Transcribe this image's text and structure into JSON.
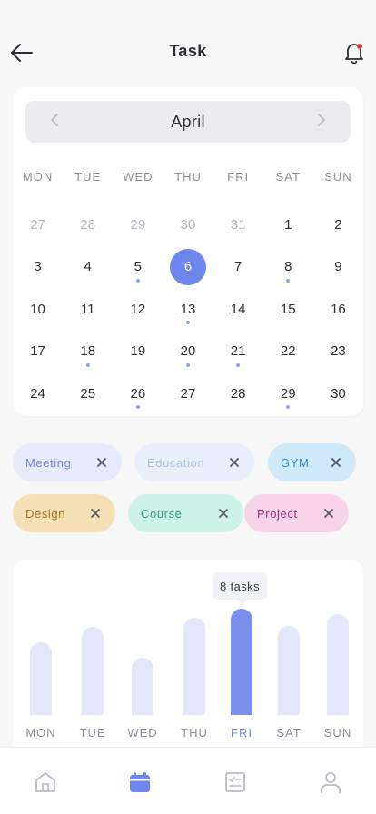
{
  "header": {
    "title": "Task"
  },
  "calendar": {
    "month": "April",
    "weekdays": [
      "MON",
      "TUE",
      "WED",
      "THU",
      "FRI",
      "SAT",
      "SUN"
    ],
    "days": [
      {
        "n": "27",
        "muted": true
      },
      {
        "n": "28",
        "muted": true
      },
      {
        "n": "29",
        "muted": true
      },
      {
        "n": "30",
        "muted": true
      },
      {
        "n": "31",
        "muted": true
      },
      {
        "n": "1"
      },
      {
        "n": "2"
      },
      {
        "n": "3"
      },
      {
        "n": "4"
      },
      {
        "n": "5",
        "dot": true
      },
      {
        "n": "6",
        "selected": true
      },
      {
        "n": "7"
      },
      {
        "n": "8",
        "dot": true
      },
      {
        "n": "9"
      },
      {
        "n": "10"
      },
      {
        "n": "11"
      },
      {
        "n": "12"
      },
      {
        "n": "13",
        "dot": true
      },
      {
        "n": "14"
      },
      {
        "n": "15"
      },
      {
        "n": "16"
      },
      {
        "n": "17"
      },
      {
        "n": "18",
        "dot": true
      },
      {
        "n": "19"
      },
      {
        "n": "20",
        "dot": true
      },
      {
        "n": "21",
        "dot": true
      },
      {
        "n": "22"
      },
      {
        "n": "23"
      },
      {
        "n": "24"
      },
      {
        "n": "25"
      },
      {
        "n": "26",
        "dot": true
      },
      {
        "n": "27"
      },
      {
        "n": "28"
      },
      {
        "n": "29",
        "dot": true
      },
      {
        "n": "30"
      }
    ]
  },
  "chips": [
    {
      "label": "Meeting",
      "bg": "#e6eafb",
      "fg": "#6f86ec",
      "x": "#555a66"
    },
    {
      "label": "Education",
      "bg": "#e9f0fc",
      "fg": "#a9c3e6",
      "x": "#555a66"
    },
    {
      "label": "GYM",
      "bg": "#cfe9fb",
      "fg": "#2f89c7",
      "x": "#555a66"
    },
    {
      "label": "Design",
      "bg": "#f5dfb4",
      "fg": "#a3731c",
      "x": "#555a66"
    },
    {
      "label": "Course",
      "bg": "#cdf3e9",
      "fg": "#2a9a80",
      "x": "#555a66"
    },
    {
      "label": "Project",
      "bg": "#f7d3ea",
      "fg": "#a42f7c",
      "x": "#555a66"
    }
  ],
  "chart_data": {
    "type": "bar",
    "categories": [
      "MON",
      "TUE",
      "WED",
      "THU",
      "FRI",
      "SAT",
      "SUN"
    ],
    "values": [
      5.5,
      6.6,
      4.3,
      7.3,
      8,
      6.7,
      7.6
    ],
    "highlight": "FRI",
    "tooltip": "8 tasks",
    "colors": {
      "bar": "#e2e7fb",
      "active": "#7b8fee"
    }
  },
  "tabs": [
    "home-icon",
    "calendar-icon",
    "tasks-icon",
    "profile-icon"
  ],
  "colors": {
    "accent": "#6f86ec",
    "muted_icon": "#b9bcc4"
  }
}
